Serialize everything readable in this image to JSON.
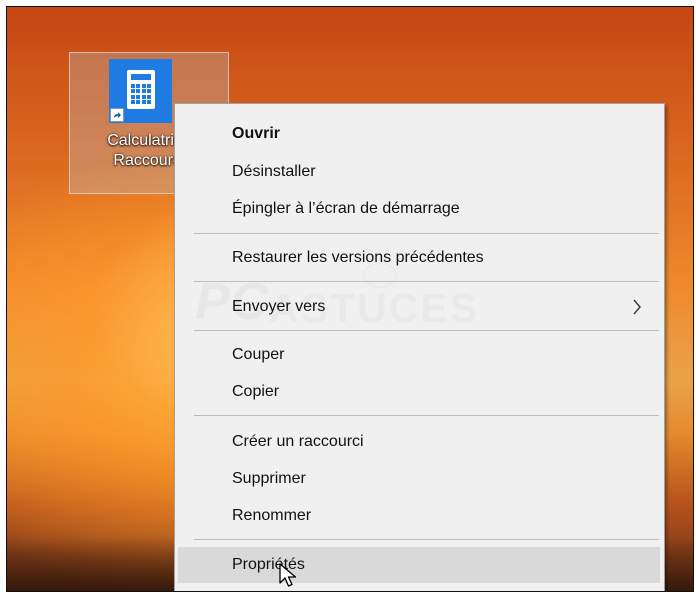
{
  "desktop": {
    "shortcut": {
      "label_line1": "Calculatrice",
      "label_line2": "Raccourci",
      "icon": "calculator-icon",
      "overlay_icon": "shortcut-arrow-icon"
    }
  },
  "context_menu": {
    "items": [
      {
        "label": "Ouvrir",
        "bold": true
      },
      {
        "label": "Désinstaller"
      },
      {
        "label": "Épingler à l’écran de démarrage"
      },
      {
        "label": "Restaurer les versions précédentes"
      },
      {
        "label": "Envoyer vers",
        "submenu": true,
        "icon": "chevron-right-icon"
      },
      {
        "label": "Couper"
      },
      {
        "label": "Copier"
      },
      {
        "label": "Créer un raccourci"
      },
      {
        "label": "Supprimer"
      },
      {
        "label": "Renommer"
      },
      {
        "label": "Propriétés",
        "highlighted": true
      }
    ],
    "watermark": {
      "left": "PC",
      "right": "ASTUCES"
    }
  },
  "colors": {
    "menu_background": "#f0f0f0",
    "menu_highlight": "#d9d9d9",
    "icon_blue": "#1f7be2"
  }
}
